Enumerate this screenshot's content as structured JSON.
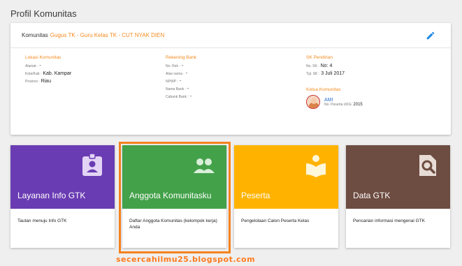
{
  "page": {
    "title": "Profil Komunitas"
  },
  "profile": {
    "prefix": "Komunitas",
    "name": "Gugus TK - Guru Kelas TK - CUT NYAK DIEN",
    "lokasi": {
      "heading": "Lokasi Komunitas",
      "rows": [
        {
          "label": "Alamat :",
          "value": "-"
        },
        {
          "label": "Kota/Kab :",
          "value": "Kab. Kampar"
        },
        {
          "label": "Provinsi :",
          "value": "Riau"
        }
      ]
    },
    "rekening": {
      "heading": "Rekening Bank",
      "rows": [
        {
          "label": "No. Rek :",
          "value": "-"
        },
        {
          "label": "Atas nama :",
          "value": "-"
        },
        {
          "label": "NPWP :",
          "value": "-"
        },
        {
          "label": "Nama Bank :",
          "value": "-"
        },
        {
          "label": "Cabank Bank :",
          "value": "-"
        }
      ]
    },
    "sk": {
      "heading": "SK Pendirian",
      "rows": [
        {
          "label": "No. SK :",
          "value": "No: 4"
        },
        {
          "label": "Tgl. SK :",
          "value": "3 Juli 2017"
        }
      ]
    },
    "ketua": {
      "heading": "Ketua Komunitas",
      "name": "AMI",
      "uk_label": "No. Peserta UKG:",
      "uk_value": "2015"
    }
  },
  "tiles": [
    {
      "title": "Layanan Info GTK",
      "desc": "Tautan menuju Info GTK",
      "color": "#6a3cb3",
      "icon": "badge-icon"
    },
    {
      "title": "Anggota Komunitasku",
      "desc": "Daftar Anggota Komunitas (kelompok kerja) Anda",
      "color": "#43a14a",
      "icon": "group-icon"
    },
    {
      "title": "Peserta",
      "desc": "Pengelolaan Calon Peserta Kelas",
      "color": "#ffb300",
      "icon": "reader-icon"
    },
    {
      "title": "Data GTK",
      "desc": "Pencarian informasi mengenai GTK",
      "color": "#6d4c41",
      "icon": "search-document-icon"
    }
  ],
  "watermark": "secercahilmu25.blogspot.com"
}
